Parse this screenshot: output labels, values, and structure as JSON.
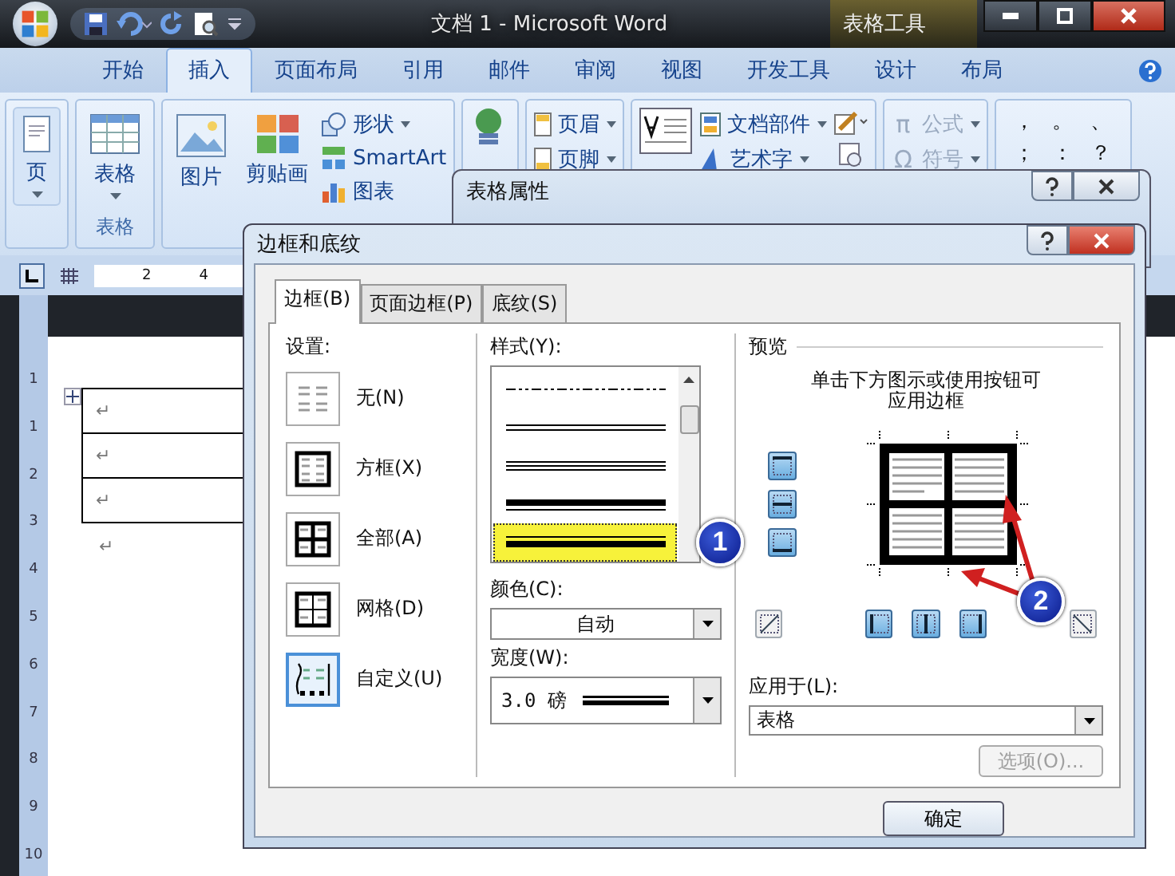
{
  "window": {
    "title": "文档 1 - Microsoft Word",
    "context_label": "表格工具"
  },
  "ribbon_tabs": [
    {
      "label": "开始",
      "selected": false
    },
    {
      "label": "插入",
      "selected": true
    },
    {
      "label": "页面布局",
      "selected": false
    },
    {
      "label": "引用",
      "selected": false
    },
    {
      "label": "邮件",
      "selected": false
    },
    {
      "label": "审阅",
      "selected": false
    },
    {
      "label": "视图",
      "selected": false
    },
    {
      "label": "开发工具",
      "selected": false
    },
    {
      "label": "设计",
      "selected": false
    },
    {
      "label": "布局",
      "selected": false
    }
  ],
  "ribbon": {
    "page": "页",
    "table": "表格",
    "table_group": "表格",
    "picture": "图片",
    "clipart": "剪贴画",
    "shapes": "形状",
    "smartart": "SmartArt",
    "chart": "图表",
    "header": "页眉",
    "footer": "页脚",
    "quick_parts": "文档部件",
    "wordart": "艺术字",
    "equation": {
      "icon": "π",
      "label": "公式",
      "disabled": true
    },
    "symbol": {
      "icon": "Ω",
      "label": "符号",
      "disabled": true
    },
    "punctuation": [
      "，",
      "。",
      "、",
      "；",
      "：",
      "？"
    ]
  },
  "ruler": {
    "horizontal": [
      "2",
      "4"
    ],
    "vertical": [
      "1",
      "1",
      "2",
      "3",
      "4",
      "5",
      "6",
      "7",
      "8",
      "9",
      "10"
    ]
  },
  "document": {
    "table_marks": [
      "↵",
      "↵",
      "↵"
    ],
    "after_table_mark": "↵"
  },
  "back_dialog": {
    "title": "表格属性"
  },
  "dialog": {
    "title": "边框和底纹",
    "tabs": [
      {
        "label": "边框(B)",
        "selected": true
      },
      {
        "label": "页面边框(P)",
        "selected": false
      },
      {
        "label": "底纹(S)",
        "selected": false
      }
    ],
    "settings_label": "设置:",
    "settings": [
      {
        "label": "无(N)",
        "kind": "none",
        "selected": false
      },
      {
        "label": "方框(X)",
        "kind": "box",
        "selected": false
      },
      {
        "label": "全部(A)",
        "kind": "all",
        "selected": false
      },
      {
        "label": "网格(D)",
        "kind": "grid",
        "selected": false
      },
      {
        "label": "自定义(U)",
        "kind": "custom",
        "selected": true
      }
    ],
    "style_label": "样式(Y):",
    "styles": [
      {
        "kind": "dash-dot-dot",
        "selected": false
      },
      {
        "kind": "double",
        "selected": false
      },
      {
        "kind": "triple",
        "selected": false
      },
      {
        "kind": "thick-thin",
        "selected": false
      },
      {
        "kind": "thin-thick",
        "selected": true
      }
    ],
    "color_label": "颜色(C):",
    "color_value": "自动",
    "width_label": "宽度(W):",
    "width_value": "3.0 磅",
    "preview_label": "预览",
    "preview_hint": "单击下方图示或使用按钮可应用边框",
    "side_buttons": [
      {
        "kind": "top",
        "on": true
      },
      {
        "kind": "inside-h",
        "on": true
      },
      {
        "kind": "bottom",
        "on": true
      }
    ],
    "bottom_buttons": [
      {
        "kind": "diag-up",
        "on": false
      },
      {
        "kind": "left",
        "on": true
      },
      {
        "kind": "inside-v",
        "on": true
      },
      {
        "kind": "right",
        "on": true
      },
      {
        "kind": "diag-down",
        "on": false
      }
    ],
    "apply_label": "应用于(L):",
    "apply_value": "表格",
    "options_button": {
      "label": "选项(O)...",
      "disabled": true
    },
    "ok_button": "确定"
  },
  "callouts": [
    "1",
    "2"
  ]
}
